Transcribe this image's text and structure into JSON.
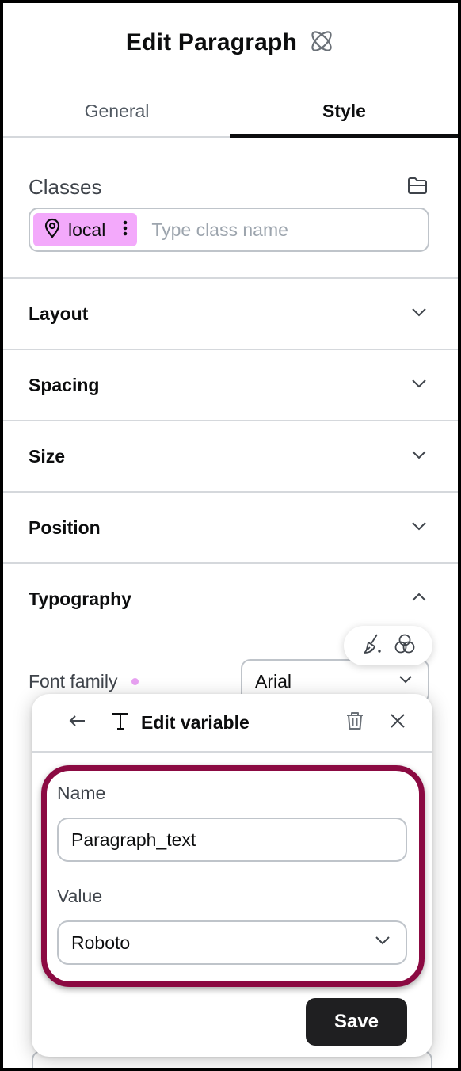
{
  "header": {
    "title": "Edit Paragraph",
    "icon": "atom-icon"
  },
  "tabs": [
    {
      "label": "General",
      "active": false
    },
    {
      "label": "Style",
      "active": true
    }
  ],
  "classes": {
    "title": "Classes",
    "icon": "folder-icon",
    "chip": {
      "label": "local",
      "icon": "map-pin-icon",
      "color": "#f3a9fb"
    },
    "placeholder": "Type class name"
  },
  "sections": [
    {
      "label": "Layout",
      "expanded": false
    },
    {
      "label": "Spacing",
      "expanded": false
    },
    {
      "label": "Size",
      "expanded": false
    },
    {
      "label": "Position",
      "expanded": false
    },
    {
      "label": "Typography",
      "expanded": true
    }
  ],
  "typography": {
    "font_family_label": "Font family",
    "font_family_value": "Arial",
    "tools": [
      "brush-icon",
      "color-circles-icon"
    ]
  },
  "edit_variable": {
    "title": "Edit variable",
    "name_label": "Name",
    "name_value": "Paragraph_text",
    "value_label": "Value",
    "value_selected": "Roboto",
    "save_label": "Save",
    "highlight_color": "#8b0a42"
  }
}
